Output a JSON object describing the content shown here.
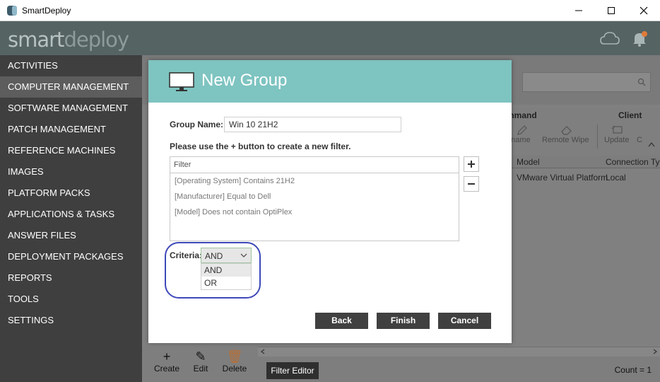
{
  "window": {
    "title": "SmartDeploy"
  },
  "header": {
    "logo_smart": "smart",
    "logo_deploy": "deploy",
    "cloud_icon": "cloud-icon",
    "notify_icon": "bell-alert-icon"
  },
  "sidebar": {
    "items": [
      {
        "label": "ACTIVITIES"
      },
      {
        "label": "COMPUTER MANAGEMENT",
        "active": true
      },
      {
        "label": "SOFTWARE MANAGEMENT"
      },
      {
        "label": "PATCH MANAGEMENT"
      },
      {
        "label": "REFERENCE MACHINES"
      },
      {
        "label": "IMAGES"
      },
      {
        "label": "PLATFORM PACKS"
      },
      {
        "label": "APPLICATIONS & TASKS"
      },
      {
        "label": "ANSWER FILES"
      },
      {
        "label": "DEPLOYMENT PACKAGES"
      },
      {
        "label": "REPORTS"
      },
      {
        "label": "TOOLS"
      },
      {
        "label": "SETTINGS"
      }
    ]
  },
  "background": {
    "ribbon_groups": {
      "command": "mmand",
      "client": "Client"
    },
    "ribbon_buttons": {
      "rename": "ename",
      "remote_wipe": "Remote Wipe",
      "update": "Update",
      "cut": "C"
    },
    "grid_headers": {
      "model": "Model",
      "connection": "Connection Typ"
    },
    "grid_row": {
      "model": "VMware Virtual Platform",
      "connection": "Local"
    },
    "bottom": {
      "create": "Create",
      "edit": "Edit",
      "delete": "Delete",
      "filter_editor": "Filter Editor",
      "count": "Count = 1"
    }
  },
  "dialog": {
    "title": "New Group",
    "group_name_label": "Group Name:",
    "group_name_value": "Win 10 21H2",
    "instruction": "Please use the + button to create a new filter.",
    "filter_header": "Filter",
    "filters": [
      "[Operating System] Contains 21H2",
      "[Manufacturer] Equal to Dell",
      "[Model] Does not contain OptiPlex"
    ],
    "criteria_label": "Criteria:",
    "criteria_value": "AND",
    "criteria_options": [
      "AND",
      "OR"
    ],
    "buttons": {
      "back": "Back",
      "finish": "Finish",
      "cancel": "Cancel"
    }
  },
  "colors": {
    "accent": "#7ec4c1",
    "sidebar": "#3f3f3f",
    "header": "#556363",
    "annotation": "#3e48b9"
  }
}
